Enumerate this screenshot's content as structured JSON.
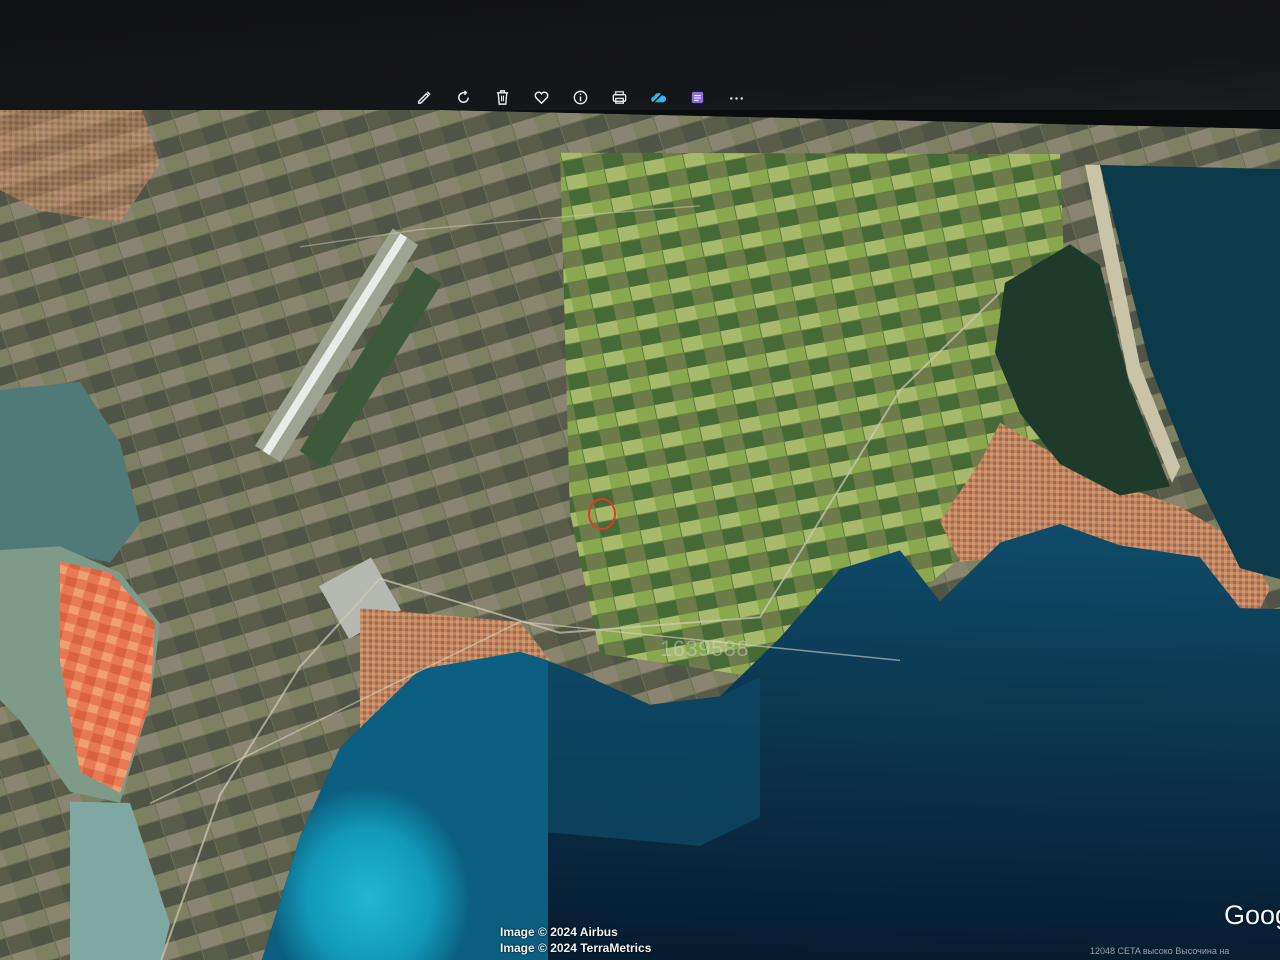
{
  "toolbar": {
    "buttons": [
      {
        "icon": "edit-icon"
      },
      {
        "icon": "rotate-icon"
      },
      {
        "icon": "delete-icon"
      },
      {
        "icon": "favorite-icon"
      },
      {
        "icon": "info-icon"
      },
      {
        "icon": "print-icon"
      },
      {
        "icon": "cloud-icon"
      },
      {
        "icon": "app-icon"
      },
      {
        "icon": "more-icon"
      }
    ]
  },
  "map": {
    "watermark": "1639588",
    "attribution": [
      "Image © 2024 Airbus",
      "Image © 2024 TerraMetrics"
    ],
    "brand": "Goog",
    "scale_text": "12048 CETA  высоко   Высочина на"
  },
  "colors": {
    "sea_deep": "#0d2f4f",
    "sea_shallow": "#17a6c4",
    "lagoon": "#1b3b2c",
    "fields": "#6f7a55",
    "salt_pans": "#e87a57",
    "town": "#c9825e",
    "marker": "#e0392d"
  }
}
